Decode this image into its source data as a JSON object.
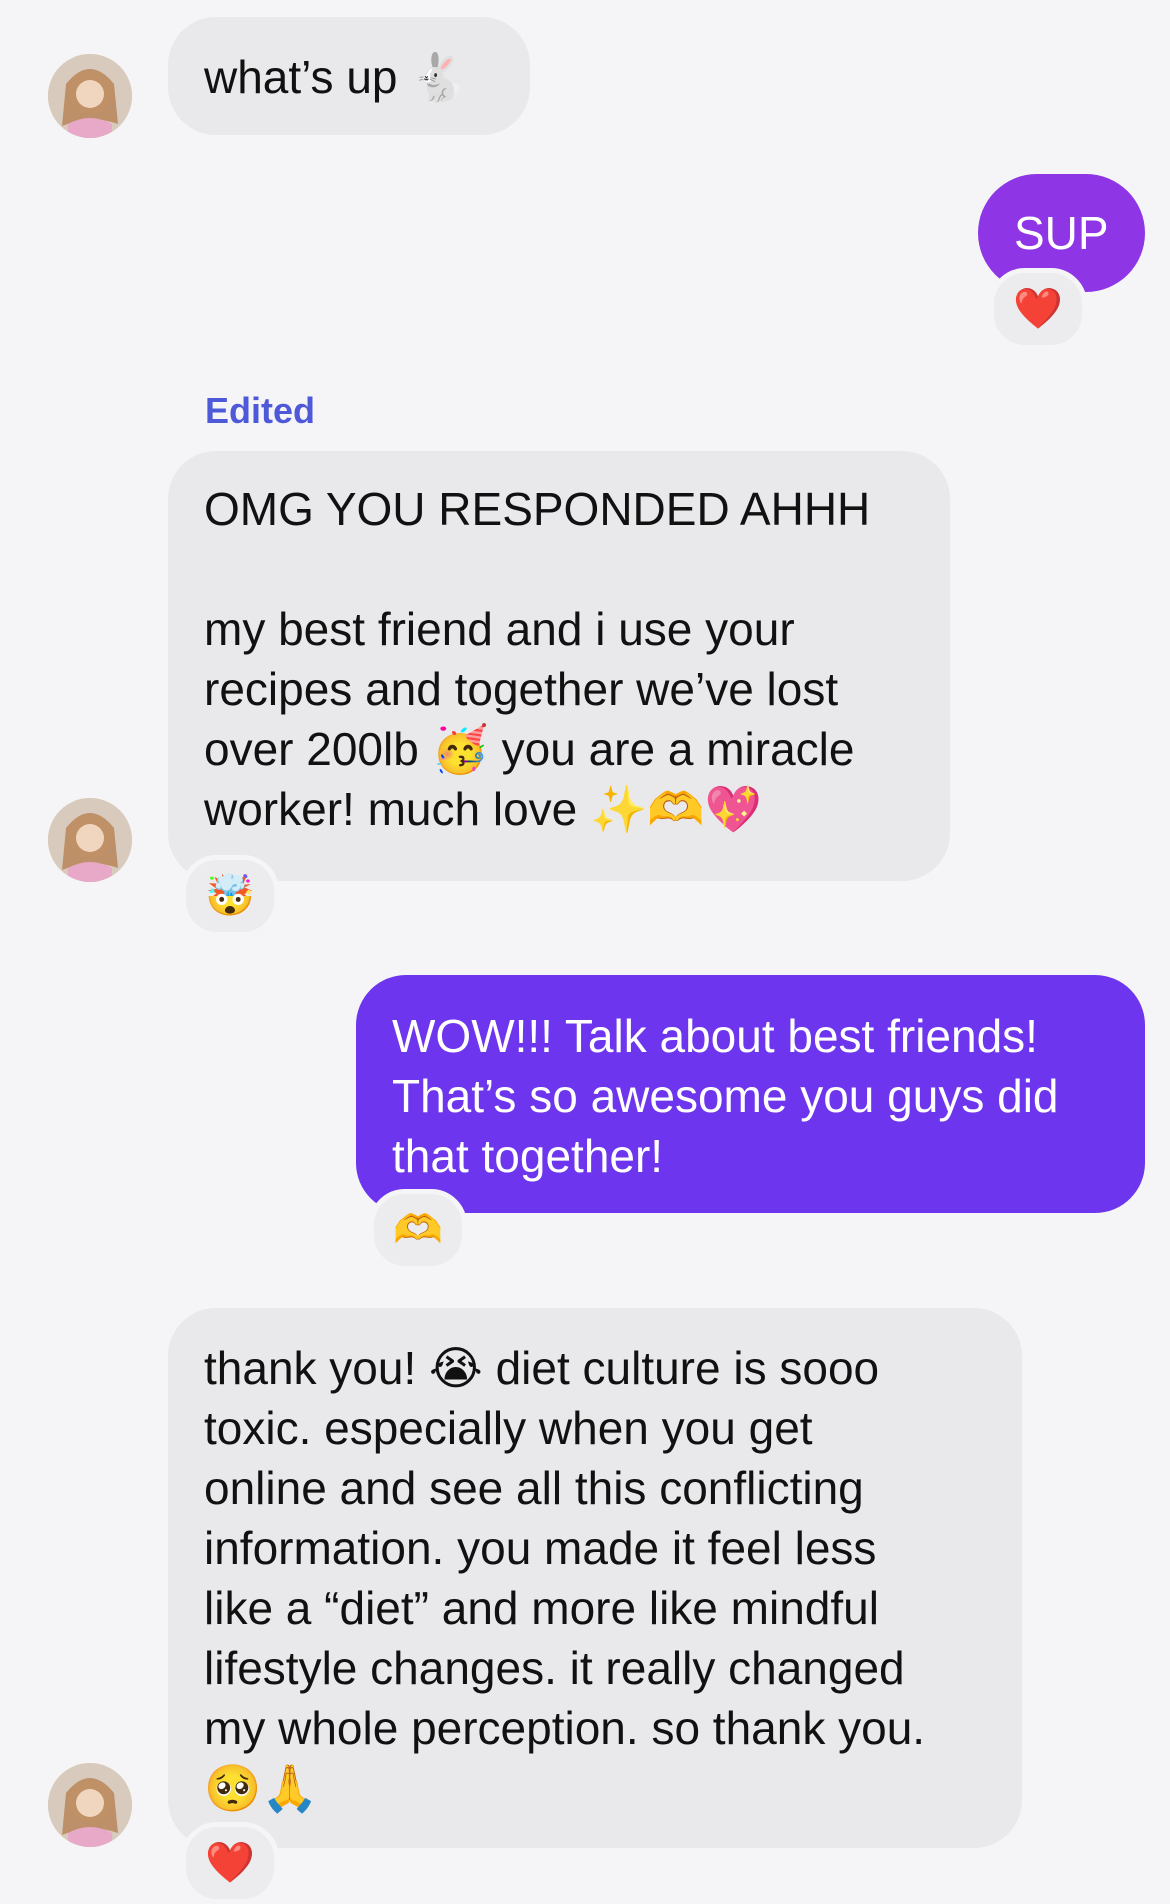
{
  "conversation": {
    "messages": [
      {
        "sender": "other",
        "text": "what’s up",
        "emoji": "🐇"
      },
      {
        "sender": "me",
        "text": "SUP",
        "reaction": "❤️"
      },
      {
        "sender": "other",
        "edited_label": "Edited",
        "lines": [
          "OMG YOU RESPONDED AHHH",
          "",
          "my best friend and i use your",
          "recipes and together we’ve lost",
          "over 200lb 🥳 you are a miracle",
          "worker! much love ✨🫶💖"
        ],
        "reaction": "🤯"
      },
      {
        "sender": "me",
        "lines": [
          "WOW!!! Talk about best friends!",
          "That’s so awesome you guys did",
          "that together!"
        ],
        "reaction": "🫶"
      },
      {
        "sender": "other",
        "lines": [
          "thank you! 😭 diet culture is sooo",
          "toxic. especially when you get",
          "online and see all this conflicting",
          "information. you made it feel less",
          "like a “diet” and more like mindful",
          "lifestyle changes. it really changed",
          "my whole perception. so thank you.",
          "🥺🙏"
        ],
        "reaction": "❤️"
      }
    ]
  },
  "colors": {
    "background": "#f5f5f7",
    "incoming_bubble": "#e9e9ec",
    "outgoing_gradient_start": "#8a2be2",
    "outgoing_gradient_end": "#6b3ff0",
    "edited_label": "#4d59d8"
  },
  "icons": {
    "avatar": "user-avatar-photo"
  }
}
